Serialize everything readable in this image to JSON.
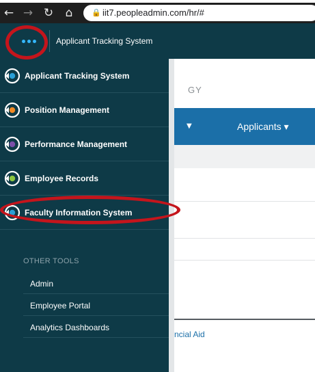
{
  "browser": {
    "url": "iit7.peopleadmin.com/hr/#",
    "icons": [
      "back-arrow-icon",
      "forward-arrow-icon",
      "reload-icon",
      "home-icon",
      "lock-icon"
    ]
  },
  "app_bar": {
    "title": "Applicant Tracking System",
    "menu_icon": "ellipsis-icon",
    "menu_icon_color": "#34b8ff",
    "background": "#0e3a47"
  },
  "flyout": {
    "apps": [
      {
        "label": "Applicant Tracking System",
        "icon": "ats-app-icon",
        "accent": "#2a9fd6"
      },
      {
        "label": "Position Management",
        "icon": "position-management-app-icon",
        "accent": "#f08a24"
      },
      {
        "label": "Performance Management",
        "icon": "performance-management-app-icon",
        "accent": "#7b4fa8"
      },
      {
        "label": "Employee Records",
        "icon": "employee-records-app-icon",
        "accent": "#8cc63f"
      },
      {
        "label": "Faculty Information System",
        "icon": "faculty-information-system-app-icon",
        "accent": "#2a9fd6"
      }
    ],
    "other_tools_heading": "OTHER TOOLS",
    "tools": [
      {
        "label": "Admin"
      },
      {
        "label": "Employee Portal"
      },
      {
        "label": "Analytics Dashboards"
      }
    ]
  },
  "background_page": {
    "section_heading_fragment": "GY",
    "nav_tab": "Applicants ▾",
    "link_fragment": "ncial Aid",
    "nav_color": "#1b6fa8"
  },
  "annotations": {
    "highlight_color": "#c4151c"
  }
}
